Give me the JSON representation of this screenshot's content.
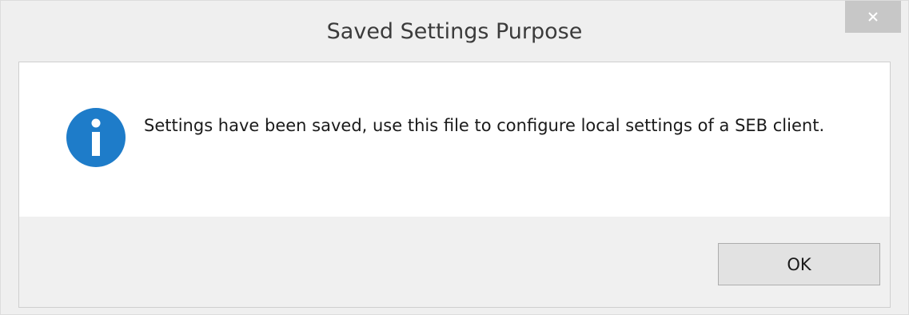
{
  "window": {
    "title": "Saved Settings Purpose",
    "close_icon": "close-icon"
  },
  "dialog": {
    "icon": "info-icon",
    "message": "Settings have been saved, use this file to configure local settings of a SEB client.",
    "ok_label": "OK"
  },
  "colors": {
    "info_blue": "#1e7cc9",
    "close_button": "#c7c7c7",
    "content_bg": "#ffffff",
    "footer_bg": "#f0f0f0"
  }
}
